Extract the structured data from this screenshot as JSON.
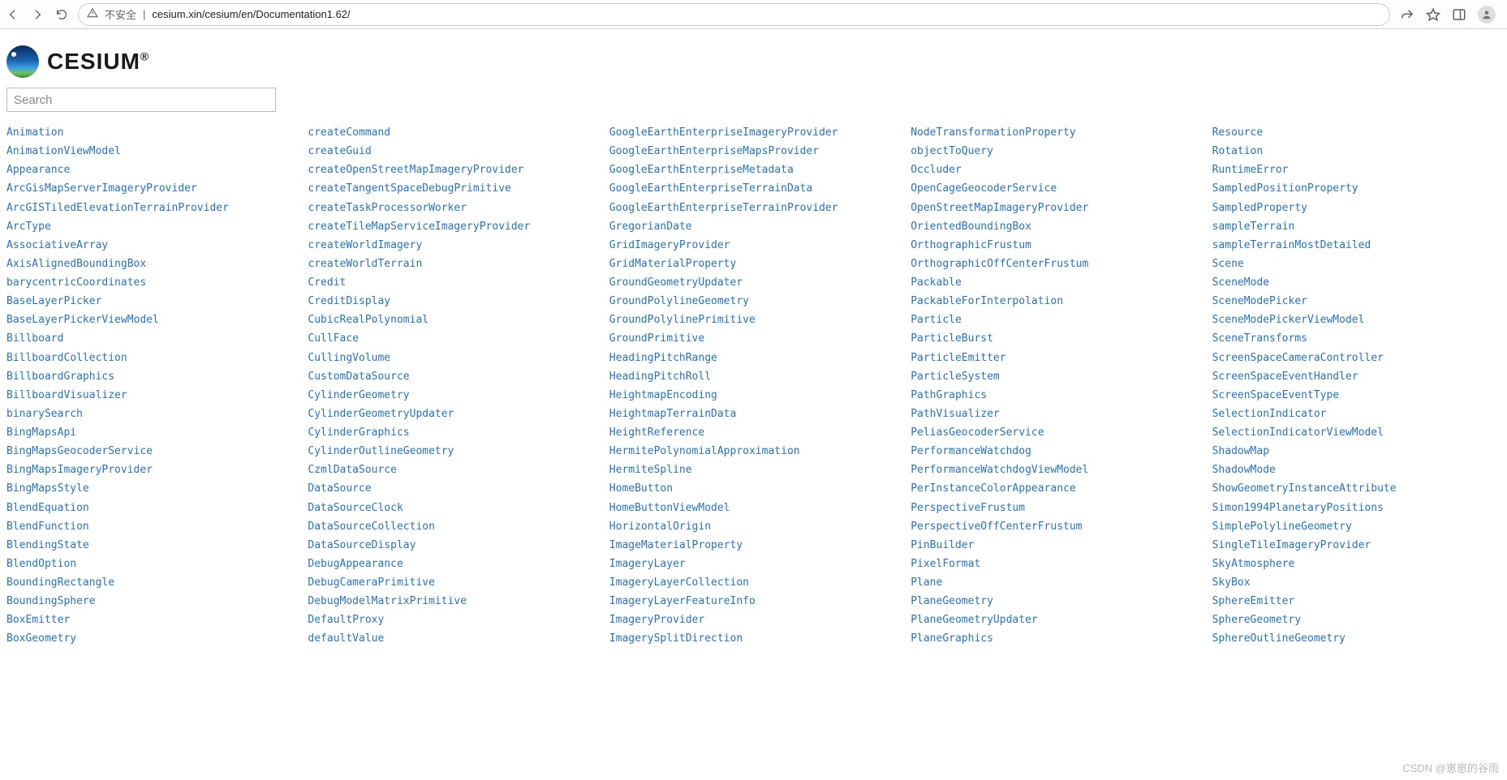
{
  "browser": {
    "security_label": "不安全",
    "url_display": "cesium.xin/cesium/en/Documentation1.62/"
  },
  "logo": {
    "text": "CESIUM",
    "registered": "®"
  },
  "search": {
    "placeholder": "Search",
    "value": ""
  },
  "watermark": "CSDN @崽崽的谷雨",
  "columns": [
    [
      "Animation",
      "AnimationViewModel",
      "Appearance",
      "ArcGisMapServerImageryProvider",
      "ArcGISTiledElevationTerrainProvider",
      "ArcType",
      "AssociativeArray",
      "AxisAlignedBoundingBox",
      "barycentricCoordinates",
      "BaseLayerPicker",
      "BaseLayerPickerViewModel",
      "Billboard",
      "BillboardCollection",
      "BillboardGraphics",
      "BillboardVisualizer",
      "binarySearch",
      "BingMapsApi",
      "BingMapsGeocoderService",
      "BingMapsImageryProvider",
      "BingMapsStyle",
      "BlendEquation",
      "BlendFunction",
      "BlendingState",
      "BlendOption",
      "BoundingRectangle",
      "BoundingSphere",
      "BoxEmitter",
      "BoxGeometry"
    ],
    [
      "createCommand",
      "createGuid",
      "createOpenStreetMapImageryProvider",
      "createTangentSpaceDebugPrimitive",
      "createTaskProcessorWorker",
      "createTileMapServiceImageryProvider",
      "createWorldImagery",
      "createWorldTerrain",
      "Credit",
      "CreditDisplay",
      "CubicRealPolynomial",
      "CullFace",
      "CullingVolume",
      "CustomDataSource",
      "CylinderGeometry",
      "CylinderGeometryUpdater",
      "CylinderGraphics",
      "CylinderOutlineGeometry",
      "CzmlDataSource",
      "DataSource",
      "DataSourceClock",
      "DataSourceCollection",
      "DataSourceDisplay",
      "DebugAppearance",
      "DebugCameraPrimitive",
      "DebugModelMatrixPrimitive",
      "DefaultProxy",
      "defaultValue"
    ],
    [
      "GoogleEarthEnterpriseImageryProvider",
      "GoogleEarthEnterpriseMapsProvider",
      "GoogleEarthEnterpriseMetadata",
      "GoogleEarthEnterpriseTerrainData",
      "GoogleEarthEnterpriseTerrainProvider",
      "GregorianDate",
      "GridImageryProvider",
      "GridMaterialProperty",
      "GroundGeometryUpdater",
      "GroundPolylineGeometry",
      "GroundPolylinePrimitive",
      "GroundPrimitive",
      "HeadingPitchRange",
      "HeadingPitchRoll",
      "HeightmapEncoding",
      "HeightmapTerrainData",
      "HeightReference",
      "HermitePolynomialApproximation",
      "HermiteSpline",
      "HomeButton",
      "HomeButtonViewModel",
      "HorizontalOrigin",
      "ImageMaterialProperty",
      "ImageryLayer",
      "ImageryLayerCollection",
      "ImageryLayerFeatureInfo",
      "ImageryProvider",
      "ImagerySplitDirection"
    ],
    [
      "NodeTransformationProperty",
      "objectToQuery",
      "Occluder",
      "OpenCageGeocoderService",
      "OpenStreetMapImageryProvider",
      "OrientedBoundingBox",
      "OrthographicFrustum",
      "OrthographicOffCenterFrustum",
      "Packable",
      "PackableForInterpolation",
      "Particle",
      "ParticleBurst",
      "ParticleEmitter",
      "ParticleSystem",
      "PathGraphics",
      "PathVisualizer",
      "PeliasGeocoderService",
      "PerformanceWatchdog",
      "PerformanceWatchdogViewModel",
      "PerInstanceColorAppearance",
      "PerspectiveFrustum",
      "PerspectiveOffCenterFrustum",
      "PinBuilder",
      "PixelFormat",
      "Plane",
      "PlaneGeometry",
      "PlaneGeometryUpdater",
      "PlaneGraphics"
    ],
    [
      "Resource",
      "Rotation",
      "RuntimeError",
      "SampledPositionProperty",
      "SampledProperty",
      "sampleTerrain",
      "sampleTerrainMostDetailed",
      "Scene",
      "SceneMode",
      "SceneModePicker",
      "SceneModePickerViewModel",
      "SceneTransforms",
      "ScreenSpaceCameraController",
      "ScreenSpaceEventHandler",
      "ScreenSpaceEventType",
      "SelectionIndicator",
      "SelectionIndicatorViewModel",
      "ShadowMap",
      "ShadowMode",
      "ShowGeometryInstanceAttribute",
      "Simon1994PlanetaryPositions",
      "SimplePolylineGeometry",
      "SingleTileImageryProvider",
      "SkyAtmosphere",
      "SkyBox",
      "SphereEmitter",
      "SphereGeometry",
      "SphereOutlineGeometry"
    ]
  ]
}
